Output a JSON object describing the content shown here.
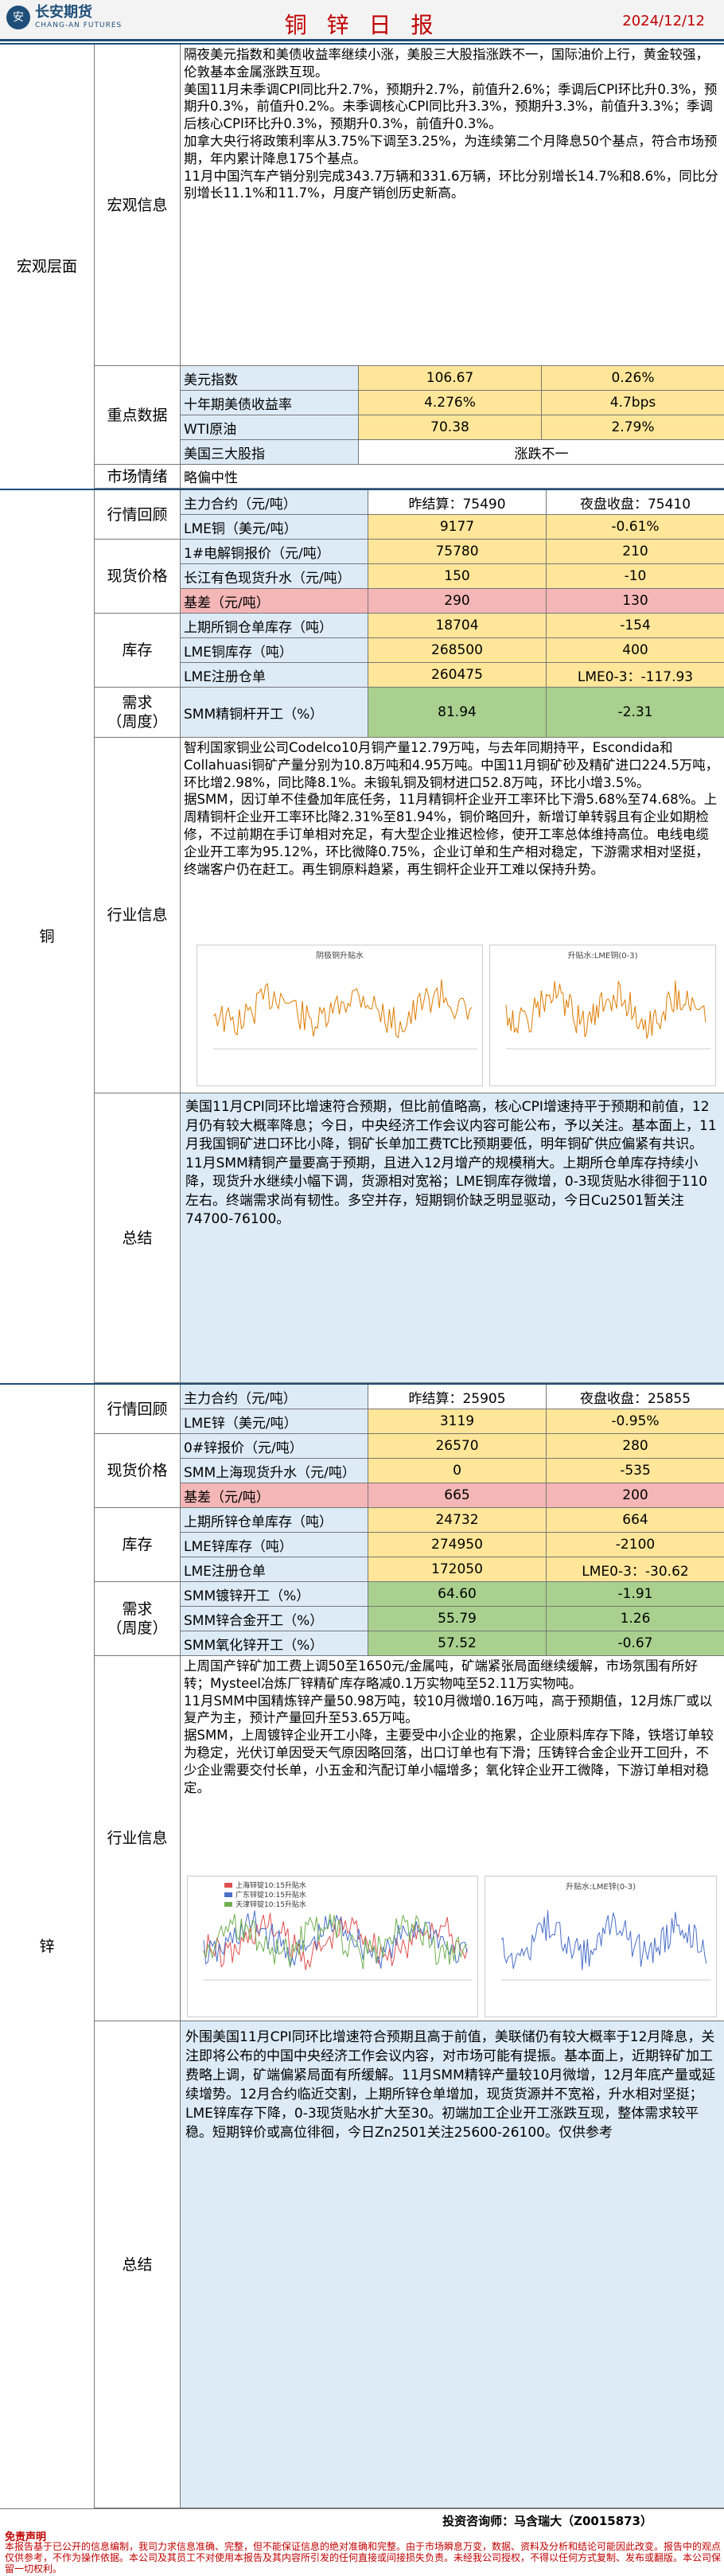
{
  "header": {
    "logo_cn": "长安期货",
    "logo_en": "CHANG-AN FUTURES",
    "title": "铜 锌 日 报",
    "date": "2024/12/12"
  },
  "macro": {
    "section": "宏观层面",
    "sub": "宏观信息",
    "text": "隔夜美元指数和美债收益率继续小涨，美股三大股指涨跌不一，国际油价上行，黄金较强，伦敦基本金属涨跌互现。\n美国11月未季调CPI同比升2.7%，预期升2.7%，前值升2.6%；季调后CPI环比升0.3%，预期升0.3%，前值升0.2%。未季调核心CPI同比升3.3%，预期升3.3%，前值升3.3%；季调后核心CPI环比升0.3%，预期升0.3%，前值升0.3%。\n加拿大央行将政策利率从3.75%下调至3.25%，为连续第二个月降息50个基点，符合市场预期，年内累计降息175个基点。\n11月中国汽车产销分别完成343.7万辆和331.6万辆，环比分别增长14.7%和8.6%，同比分别增长11.1%和11.7%，月度产销创历史新高。",
    "key_label": "重点数据",
    "key": [
      [
        "美元指数",
        "106.67",
        "0.26%"
      ],
      [
        "十年期美债收益率",
        "4.276%",
        "4.7bps"
      ],
      [
        "WTI原油",
        "70.38",
        "2.79%"
      ],
      [
        "美国三大股指",
        "涨跌不一",
        ""
      ]
    ],
    "sentiment_label": "市场情绪",
    "sentiment": "略偏中性"
  },
  "copper": {
    "section": "铜",
    "l_market": "行情回顾",
    "l_spot": "现货价格",
    "l_stock": "库存",
    "l_demand": "需求\n（周度）",
    "l_industry": "行业信息",
    "l_summary": "总结",
    "market": [
      [
        "主力合约（元/吨）",
        "昨结算：75490",
        "夜盘收盘：75410"
      ],
      [
        "LME铜（美元/吨）",
        "9177",
        "-0.61%"
      ]
    ],
    "spot": [
      [
        "1#电解铜报价（元/吨）",
        "75780",
        "210"
      ],
      [
        "长江有色现货升水（元/吨）",
        "150",
        "-10"
      ],
      [
        "基差（元/吨）",
        "290",
        "130"
      ]
    ],
    "stock": [
      [
        "上期所铜仓单库存（吨）",
        "18704",
        "-154"
      ],
      [
        "LME铜库存（吨）",
        "268500",
        "400"
      ],
      [
        "LME注册仓单",
        "260475",
        "LME0-3：-117.93"
      ]
    ],
    "demand": [
      [
        "SMM精铜杆开工（%）",
        "81.94",
        "-2.31"
      ]
    ],
    "industry": "智利国家铜业公司Codelco10月铜产量12.79万吨，与去年同期持平，Escondida和Collahuasi铜矿产量分别为10.8万吨和4.95万吨。中国11月铜矿砂及精矿进口224.5万吨，环比增2.98%，同比降8.1%。未锻轧铜及铜材进口52.8万吨，环比小增3.5%。\n据SMM，因订单不佳叠加年底任务，11月精铜杆企业开工率环比下滑5.68%至74.68%。上周精铜杆企业开工率环比降2.31%至81.94%，铜价略回升，新增订单转弱且有企业如期检修，不过前期在手订单相对充足，有大型企业推迟检修，使开工率总体维持高位。电线电缆企业开工率为95.12%，环比微降0.75%，企业订单和生产相对稳定，下游需求相对坚挺，终端客户仍在赶工。再生铜原料趋紧，再生铜杆企业开工难以保持升势。",
    "chart1_title": "阴极铜升贴水",
    "chart2_title": "升贴水:LME铜(0-3)",
    "summary": "美国11月CPI同环比增速符合预期，但比前值略高，核心CPI增速持平于预期和前值，12月仍有较大概率降息；今日，中央经济工作会议内容可能公布，予以关注。基本面上，11月我国铜矿进口环比小降，铜矿长单加工费TC比预期要低，明年铜矿供应偏紧有共识。11月SMM精铜产量要高于预期，且进入12月增产的规模稍大。上期所仓单库存持续小降，现货升水继续小幅下调，货源相对宽裕；LME铜库存微增，0-3现货贴水徘徊于110左右。终端需求尚有韧性。多空并存，短期铜价缺乏明显驱动，今日Cu2501暂关注74700-76100。"
  },
  "zinc": {
    "section": "锌",
    "l_market": "行情回顾",
    "l_spot": "现货价格",
    "l_stock": "库存",
    "l_demand": "需求\n（周度）",
    "l_industry": "行业信息",
    "l_summary": "总结",
    "market": [
      [
        "主力合约（元/吨）",
        "昨结算：25905",
        "夜盘收盘：25855"
      ],
      [
        "LME锌（美元/吨）",
        "3119",
        "-0.95%"
      ]
    ],
    "spot": [
      [
        "0#锌报价（元/吨）",
        "26570",
        "280"
      ],
      [
        "SMM上海现货升水（元/吨）",
        "0",
        "-535"
      ],
      [
        "基差（元/吨）",
        "665",
        "200"
      ]
    ],
    "stock": [
      [
        "上期所锌仓单库存（吨）",
        "24732",
        "664"
      ],
      [
        "LME锌库存（吨）",
        "274950",
        "-2100"
      ],
      [
        "LME注册仓单",
        "172050",
        "LME0-3：-30.62"
      ]
    ],
    "demand": [
      [
        "SMM镀锌开工（%）",
        "64.60",
        "-1.91"
      ],
      [
        "SMM锌合金开工（%）",
        "55.79",
        "1.26"
      ],
      [
        "SMM氧化锌开工（%）",
        "57.52",
        "-0.67"
      ]
    ],
    "industry": "上周国产锌矿加工费上调50至1650元/金属吨，矿端紧张局面继续缓解，市场氛围有所好转；Mysteel冶炼厂锌精矿库存略减0.1万实物吨至52.11万实物吨。\n11月SMM中国精炼锌产量50.98万吨，较10月微增0.16万吨，高于预期值，12月炼厂或以复产为主，预计产量回升至53.65万吨。\n据SMM，上周镀锌企业开工小降，主要受中小企业的拖累，企业原料库存下降，铁塔订单较为稳定，光伏订单因受天气原因略回落，出口订单也有下滑；压铸锌合金企业开工回升，不少企业需要交付长单，小五金和汽配订单小幅增多；氧化锌企业开工微降，下游订单相对稳定。",
    "chart1_legend": [
      "上海锌锭10:15升贴水",
      "广东锌锭10:15升贴水",
      "天津锌锭10:15升贴水"
    ],
    "chart2_title": "升贴水:LME锌(0-3)",
    "summary": "外围美国11月CPI同环比增速符合预期且高于前值，美联储仍有较大概率于12月降息，关注即将公布的中国中央经济工作会议内容，对市场可能有提振。基本面上，近期锌矿加工费略上调，矿端偏紧局面有所缓解。11月SMM精锌产量较10月微增，12月年底产量或延续增势。12月合约临近交割，上期所锌仓单增加，现货货源并不宽裕，升水相对坚挺；LME锌库存下降，0-3现货贴水扩大至30。初端加工企业开工涨跌互现，整体需求较平稳。短期锌价或高位徘徊，今日Zn2501关注25600-26100。仅供参考"
  },
  "footer": {
    "contact": "投资咨询师：马含瑞大（Z0015873）",
    "disclaimer_title": "免责声明",
    "disclaimer": "本报告基于已公开的信息编制，我司力求信息准确、完整，但不能保证信息的绝对准确和完整。由于市场瞬息万变，数据、资料及分析和结论可能因此改变。报告中的观点仅供参考，不作为操作依据。本公司及其员工不对使用本报告及其内容所引发的任何直接或间接损失负责。未经我公司授权，不得以任何方式复制、发布或翻版。本公司保留一切权利。"
  },
  "colors": {
    "brand": "#1f4e79",
    "red": "#c00000",
    "yellow": "#ffe699",
    "blue": "#ddebf7",
    "pink": "#f4b6b6",
    "green": "#a9d08e"
  }
}
